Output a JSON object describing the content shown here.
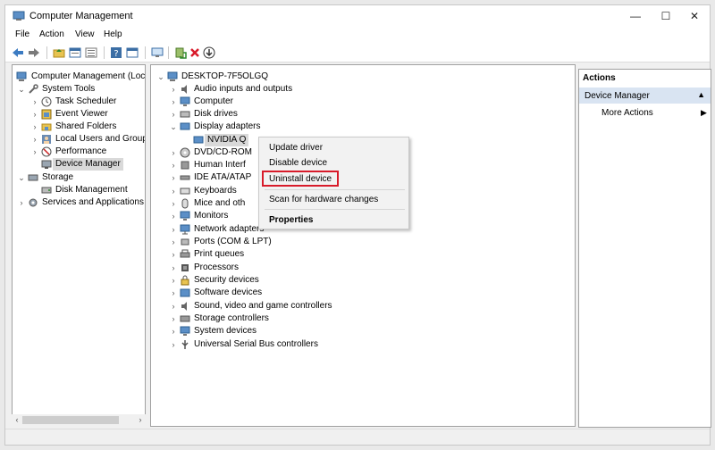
{
  "window": {
    "title": "Computer Management"
  },
  "window_controls": {
    "minimize": "—",
    "maximize": "☐",
    "close": "✕"
  },
  "menu": [
    "File",
    "Action",
    "View",
    "Help"
  ],
  "left_tree": [
    {
      "label": "Computer Management (Local",
      "icon": "computer-management-icon",
      "chev": ""
    },
    {
      "label": "System Tools",
      "icon": "system-tools-icon",
      "chev": "v"
    },
    {
      "label": "Task Scheduler",
      "icon": "clock-icon",
      "chev": ">"
    },
    {
      "label": "Event Viewer",
      "icon": "event-viewer-icon",
      "chev": ">"
    },
    {
      "label": "Shared Folders",
      "icon": "shared-folder-icon",
      "chev": ">"
    },
    {
      "label": "Local Users and Groups",
      "icon": "users-icon",
      "chev": ">"
    },
    {
      "label": "Performance",
      "icon": "performance-icon",
      "chev": ">"
    },
    {
      "label": "Device Manager",
      "icon": "device-manager-icon",
      "chev": ""
    },
    {
      "label": "Storage",
      "icon": "storage-icon",
      "chev": "v"
    },
    {
      "label": "Disk Management",
      "icon": "disk-management-icon",
      "chev": ""
    },
    {
      "label": "Services and Applications",
      "icon": "services-icon",
      "chev": ">"
    }
  ],
  "device_tree": {
    "root": "DESKTOP-7F5OLGQ",
    "items": [
      {
        "label": "Audio inputs and outputs",
        "icon": "speaker-icon",
        "chev": ">"
      },
      {
        "label": "Computer",
        "icon": "monitor-icon",
        "chev": ">"
      },
      {
        "label": "Disk drives",
        "icon": "disk-icon",
        "chev": ">"
      },
      {
        "label": "Display adapters",
        "icon": "display-adapter-icon",
        "chev": "v"
      },
      {
        "label": "NVIDIA Q",
        "icon": "display-adapter-icon",
        "chev": ""
      },
      {
        "label": "DVD/CD-ROM",
        "icon": "dvd-icon",
        "chev": ">"
      },
      {
        "label": "Human Interf",
        "icon": "hid-icon",
        "chev": ">"
      },
      {
        "label": "IDE ATA/ATAP",
        "icon": "ide-icon",
        "chev": ">"
      },
      {
        "label": "Keyboards",
        "icon": "keyboard-icon",
        "chev": ">"
      },
      {
        "label": "Mice and oth",
        "icon": "mouse-icon",
        "chev": ">"
      },
      {
        "label": "Monitors",
        "icon": "monitor-icon",
        "chev": ">"
      },
      {
        "label": "Network adapters",
        "icon": "network-icon",
        "chev": ">"
      },
      {
        "label": "Ports (COM & LPT)",
        "icon": "port-icon",
        "chev": ">"
      },
      {
        "label": "Print queues",
        "icon": "printer-icon",
        "chev": ">"
      },
      {
        "label": "Processors",
        "icon": "processor-icon",
        "chev": ">"
      },
      {
        "label": "Security devices",
        "icon": "security-icon",
        "chev": ">"
      },
      {
        "label": "Software devices",
        "icon": "software-icon",
        "chev": ">"
      },
      {
        "label": "Sound, video and game controllers",
        "icon": "sound-icon",
        "chev": ">"
      },
      {
        "label": "Storage controllers",
        "icon": "storage-controller-icon",
        "chev": ">"
      },
      {
        "label": "System devices",
        "icon": "system-device-icon",
        "chev": ">"
      },
      {
        "label": "Universal Serial Bus controllers",
        "icon": "usb-icon",
        "chev": ">"
      }
    ]
  },
  "context_menu": {
    "update_driver": "Update driver",
    "disable_device": "Disable device",
    "uninstall_device": "Uninstall device",
    "scan": "Scan for hardware changes",
    "properties": "Properties"
  },
  "actions": {
    "header": "Actions",
    "section": "Device Manager",
    "more_actions": "More Actions"
  },
  "colors": {
    "highlight_box": "#d81b2a",
    "actions_section": "#d9e4f2",
    "selection": "#d9d9d9"
  }
}
